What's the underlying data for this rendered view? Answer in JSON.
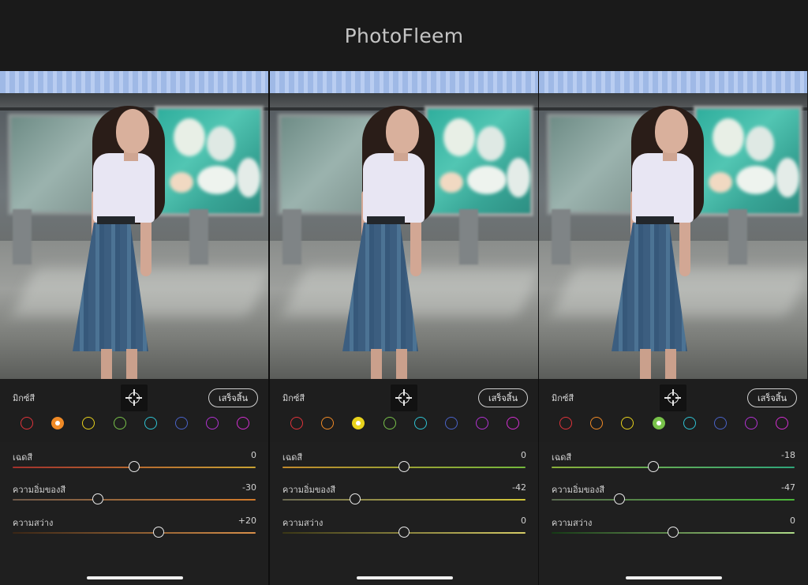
{
  "app": {
    "title": "PhotoFleem"
  },
  "panels": [
    {
      "mix_label": "มิกซ์สี",
      "done_label": "เสร็จสิ้น",
      "swatches": [
        {
          "color": "#e0343b"
        },
        {
          "color": "#f08a26",
          "selected": true
        },
        {
          "color": "#e8d21c"
        },
        {
          "color": "#78c24a"
        },
        {
          "color": "#2fc3d3"
        },
        {
          "color": "#4a63c8"
        },
        {
          "color": "#b233d1"
        },
        {
          "color": "#d42fd0"
        }
      ],
      "sliders": [
        {
          "label": "เฉดสี",
          "value": "0",
          "level": 0.5,
          "grad_from": "#a2302c",
          "grad_to": "#c9a233"
        },
        {
          "label": "ความอิ่มของสี",
          "value": "-30",
          "level": 0.35,
          "grad_from": "#6f5a4a",
          "grad_to": "#d27a2a"
        },
        {
          "label": "ความสว่าง",
          "value": "+20",
          "level": 0.6,
          "grad_from": "#3a2616",
          "grad_to": "#d9904a"
        }
      ]
    },
    {
      "mix_label": "มิกซ์สี",
      "done_label": "เสร็จสิ้น",
      "swatches": [
        {
          "color": "#e0343b"
        },
        {
          "color": "#f08a26"
        },
        {
          "color": "#e8d21c",
          "selected": true
        },
        {
          "color": "#78c24a"
        },
        {
          "color": "#2fc3d3"
        },
        {
          "color": "#4a63c8"
        },
        {
          "color": "#b233d1"
        },
        {
          "color": "#d42fd0"
        }
      ],
      "sliders": [
        {
          "label": "เฉดสี",
          "value": "0",
          "level": 0.5,
          "grad_from": "#c28a2c",
          "grad_to": "#74b83c"
        },
        {
          "label": "ความอิ่มของสี",
          "value": "-42",
          "level": 0.3,
          "grad_from": "#6c6a52",
          "grad_to": "#d2c63a"
        },
        {
          "label": "ความสว่าง",
          "value": "0",
          "level": 0.5,
          "grad_from": "#3a3616",
          "grad_to": "#d6cc66"
        }
      ]
    },
    {
      "mix_label": "มิกซ์สี",
      "done_label": "เสร็จสิ้น",
      "swatches": [
        {
          "color": "#e0343b"
        },
        {
          "color": "#f08a26"
        },
        {
          "color": "#e8d21c"
        },
        {
          "color": "#78c24a",
          "selected": true
        },
        {
          "color": "#2fc3d3"
        },
        {
          "color": "#4a63c8"
        },
        {
          "color": "#b233d1"
        },
        {
          "color": "#d42fd0"
        }
      ],
      "sliders": [
        {
          "label": "เฉดสี",
          "value": "-18",
          "level": 0.42,
          "grad_from": "#8ab03a",
          "grad_to": "#2fa67a"
        },
        {
          "label": "ความอิ่มของสี",
          "value": "-47",
          "level": 0.28,
          "grad_from": "#5a6a50",
          "grad_to": "#4cb83a"
        },
        {
          "label": "ความสว่าง",
          "value": "0",
          "level": 0.5,
          "grad_from": "#163a16",
          "grad_to": "#aedb88"
        }
      ]
    }
  ]
}
